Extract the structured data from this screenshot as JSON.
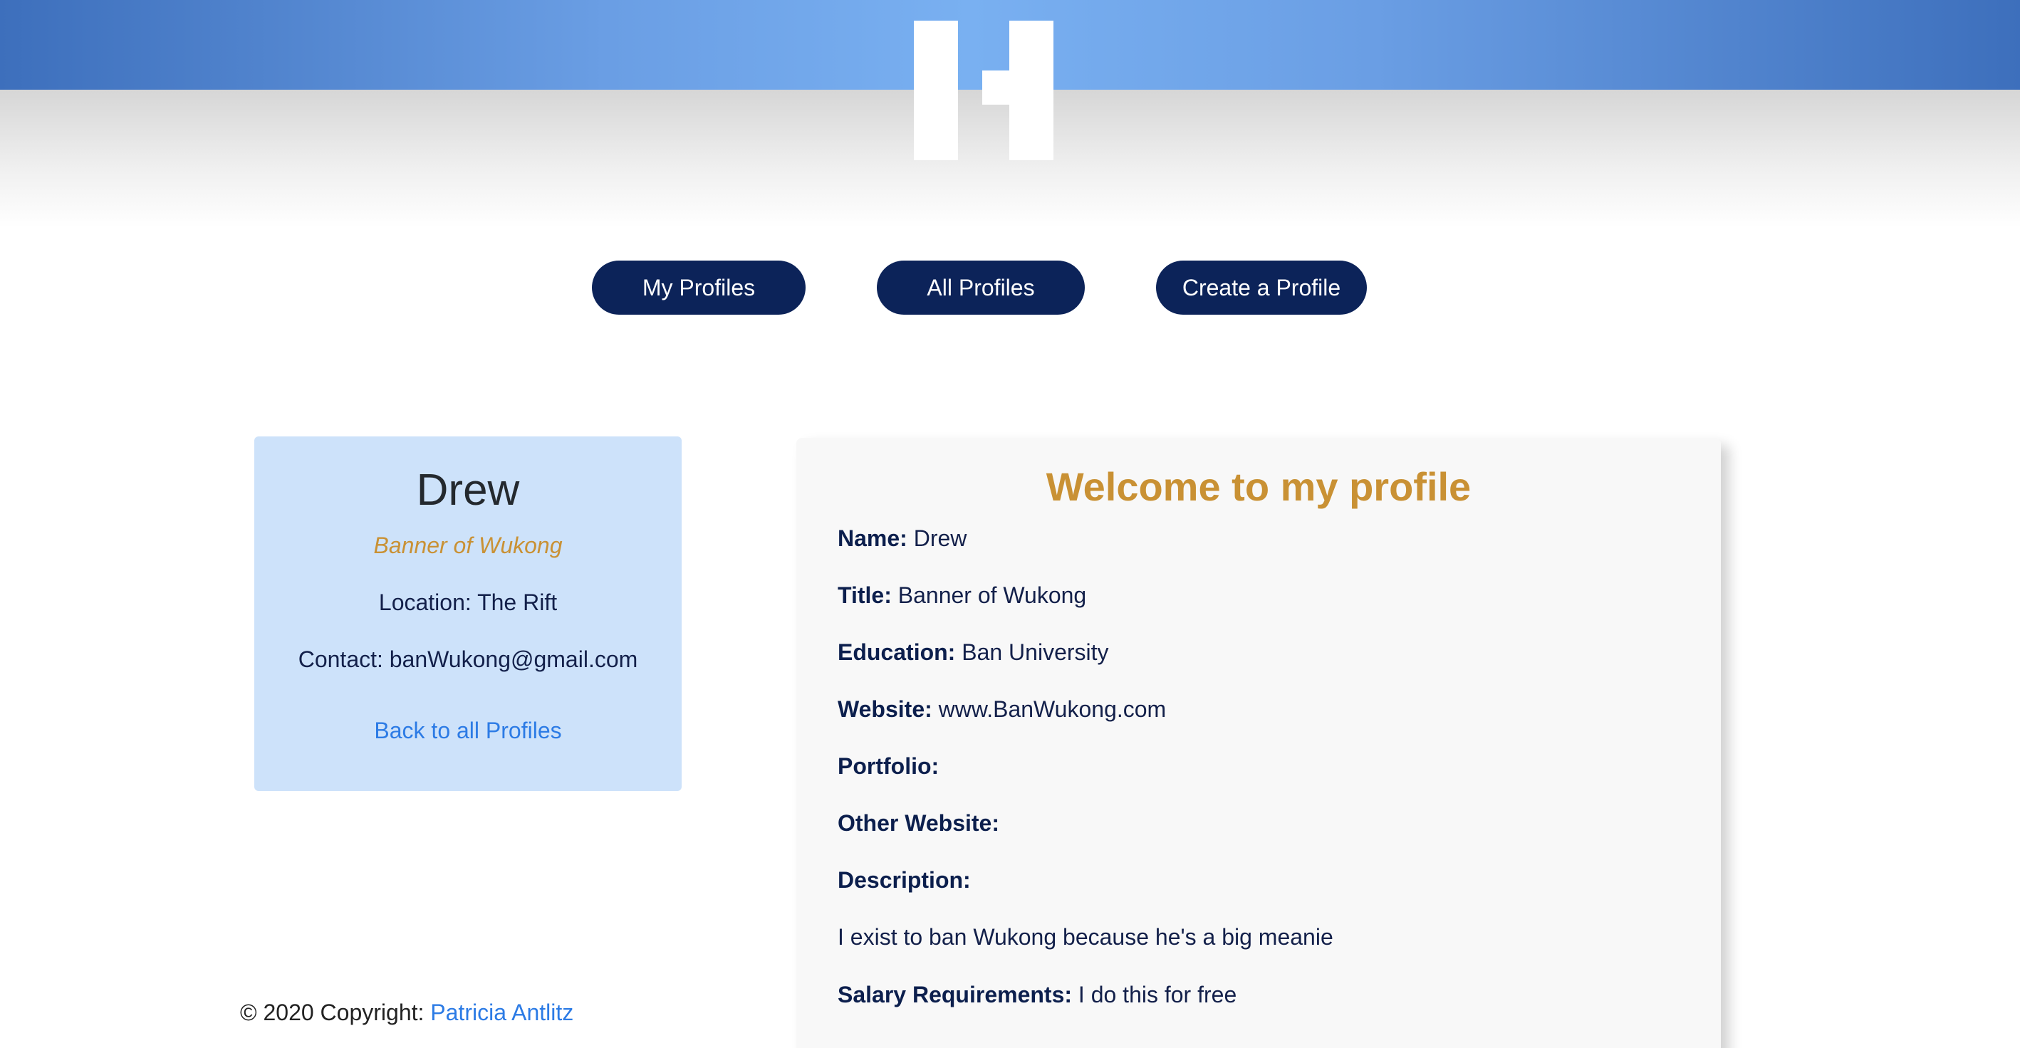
{
  "nav": {
    "my_profiles": "My Profiles",
    "all_profiles": "All Profiles",
    "create_profile": "Create a Profile"
  },
  "card": {
    "name": "Drew",
    "title": "Banner of Wukong",
    "location": "Location: The Rift",
    "contact": "Contact: banWukong@gmail.com",
    "back_link": "Back to all Profiles"
  },
  "panel": {
    "heading": "Welcome to my profile",
    "rows": [
      {
        "label": "Name:",
        "value": " Drew"
      },
      {
        "label": "Title:",
        "value": " Banner of Wukong"
      },
      {
        "label": "Education:",
        "value": " Ban University"
      },
      {
        "label": "Website:",
        "value": " www.BanWukong.com"
      },
      {
        "label": "Portfolio:",
        "value": ""
      },
      {
        "label": "Other Website:",
        "value": ""
      },
      {
        "label": "Description:",
        "value": ""
      },
      {
        "label": "",
        "value": "I exist to ban Wukong because he's a big meanie"
      },
      {
        "label": "Salary Requirements:",
        "value": " I do this for free"
      }
    ]
  },
  "footer": {
    "copyright": "© 2020 Copyright: ",
    "author": "Patricia Antlitz"
  },
  "colors": {
    "header_blue": "#79b0f1",
    "nav_button": "#0c2359",
    "accent_gold": "#c99134",
    "card_bg": "#cde2fa",
    "link_blue": "#2c7be5"
  },
  "icons": {
    "logo": "logo-icon"
  }
}
